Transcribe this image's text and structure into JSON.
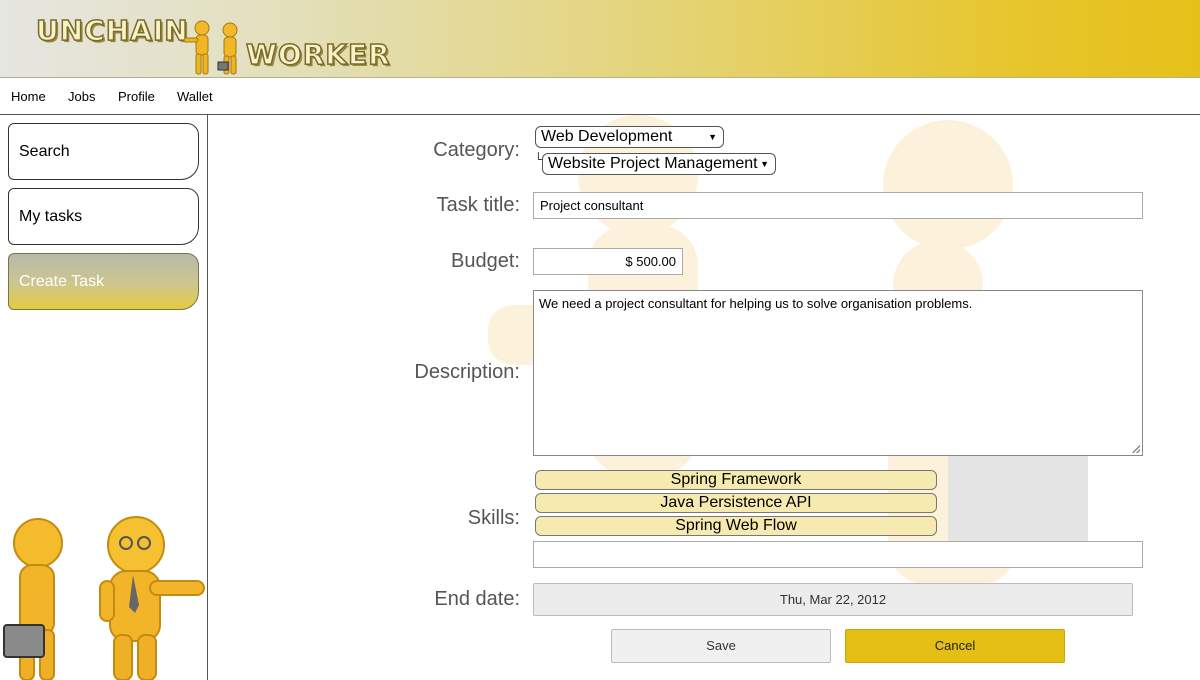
{
  "header": {
    "logo_word_1": "UNCHAIN",
    "logo_word_2": "WORKER"
  },
  "nav": {
    "items": [
      "Home",
      "Jobs",
      "Profile",
      "Wallet"
    ]
  },
  "sidebar": {
    "items": [
      {
        "label": "Search",
        "active": false
      },
      {
        "label": "My tasks",
        "active": false
      },
      {
        "label": "Create Task",
        "active": true
      }
    ]
  },
  "form": {
    "category_label": "Category:",
    "category_value": "Web Development",
    "subcategory_value": "Website Project Management",
    "tree_mark": "└",
    "title_label": "Task title:",
    "title_value": "Project consultant",
    "budget_label": "Budget:",
    "budget_value": "$ 500.00",
    "description_label": "Description:",
    "description_value": "We need a project consultant for helping us to solve organisation problems.",
    "skills_label": "Skills:",
    "skills": [
      "Spring Framework",
      "Java Persistence API",
      "Spring Web Flow"
    ],
    "skill_input_value": "",
    "end_date_label": "End date:",
    "end_date_value": "Thu, Mar 22, 2012",
    "save_label": "Save",
    "cancel_label": "Cancel"
  },
  "colors": {
    "accent": "#e6c11a",
    "skill_tag": "#f6eab0",
    "cancel_button": "#e5bf14"
  }
}
